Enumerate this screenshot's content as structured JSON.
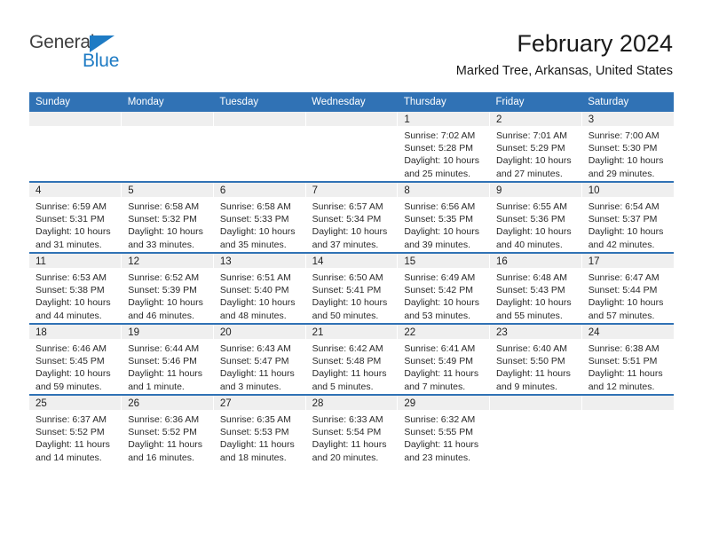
{
  "brand": {
    "name_part1": "General",
    "name_part2": "Blue",
    "triangle_icon": "triangle-icon",
    "color_dark": "#3F3F3F",
    "color_blue": "#1E7BC4"
  },
  "header": {
    "title": "February 2024",
    "subtitle": "Marked Tree, Arkansas, United States"
  },
  "theme": {
    "header_blue": "#3072B5",
    "daynum_band": "#EFEFEF",
    "text": "#2A2A2A"
  },
  "weekday_headers": [
    "Sunday",
    "Monday",
    "Tuesday",
    "Wednesday",
    "Thursday",
    "Friday",
    "Saturday"
  ],
  "weeks": [
    [
      {
        "blank": true,
        "day": ""
      },
      {
        "blank": true,
        "day": ""
      },
      {
        "blank": true,
        "day": ""
      },
      {
        "blank": true,
        "day": ""
      },
      {
        "blank": false,
        "day": "1",
        "sunrise": "Sunrise: 7:02 AM",
        "sunset": "Sunset: 5:28 PM",
        "daylight_line1": "Daylight: 10 hours",
        "daylight_line2": "and 25 minutes."
      },
      {
        "blank": false,
        "day": "2",
        "sunrise": "Sunrise: 7:01 AM",
        "sunset": "Sunset: 5:29 PM",
        "daylight_line1": "Daylight: 10 hours",
        "daylight_line2": "and 27 minutes."
      },
      {
        "blank": false,
        "day": "3",
        "sunrise": "Sunrise: 7:00 AM",
        "sunset": "Sunset: 5:30 PM",
        "daylight_line1": "Daylight: 10 hours",
        "daylight_line2": "and 29 minutes."
      }
    ],
    [
      {
        "blank": false,
        "day": "4",
        "sunrise": "Sunrise: 6:59 AM",
        "sunset": "Sunset: 5:31 PM",
        "daylight_line1": "Daylight: 10 hours",
        "daylight_line2": "and 31 minutes."
      },
      {
        "blank": false,
        "day": "5",
        "sunrise": "Sunrise: 6:58 AM",
        "sunset": "Sunset: 5:32 PM",
        "daylight_line1": "Daylight: 10 hours",
        "daylight_line2": "and 33 minutes."
      },
      {
        "blank": false,
        "day": "6",
        "sunrise": "Sunrise: 6:58 AM",
        "sunset": "Sunset: 5:33 PM",
        "daylight_line1": "Daylight: 10 hours",
        "daylight_line2": "and 35 minutes."
      },
      {
        "blank": false,
        "day": "7",
        "sunrise": "Sunrise: 6:57 AM",
        "sunset": "Sunset: 5:34 PM",
        "daylight_line1": "Daylight: 10 hours",
        "daylight_line2": "and 37 minutes."
      },
      {
        "blank": false,
        "day": "8",
        "sunrise": "Sunrise: 6:56 AM",
        "sunset": "Sunset: 5:35 PM",
        "daylight_line1": "Daylight: 10 hours",
        "daylight_line2": "and 39 minutes."
      },
      {
        "blank": false,
        "day": "9",
        "sunrise": "Sunrise: 6:55 AM",
        "sunset": "Sunset: 5:36 PM",
        "daylight_line1": "Daylight: 10 hours",
        "daylight_line2": "and 40 minutes."
      },
      {
        "blank": false,
        "day": "10",
        "sunrise": "Sunrise: 6:54 AM",
        "sunset": "Sunset: 5:37 PM",
        "daylight_line1": "Daylight: 10 hours",
        "daylight_line2": "and 42 minutes."
      }
    ],
    [
      {
        "blank": false,
        "day": "11",
        "sunrise": "Sunrise: 6:53 AM",
        "sunset": "Sunset: 5:38 PM",
        "daylight_line1": "Daylight: 10 hours",
        "daylight_line2": "and 44 minutes."
      },
      {
        "blank": false,
        "day": "12",
        "sunrise": "Sunrise: 6:52 AM",
        "sunset": "Sunset: 5:39 PM",
        "daylight_line1": "Daylight: 10 hours",
        "daylight_line2": "and 46 minutes."
      },
      {
        "blank": false,
        "day": "13",
        "sunrise": "Sunrise: 6:51 AM",
        "sunset": "Sunset: 5:40 PM",
        "daylight_line1": "Daylight: 10 hours",
        "daylight_line2": "and 48 minutes."
      },
      {
        "blank": false,
        "day": "14",
        "sunrise": "Sunrise: 6:50 AM",
        "sunset": "Sunset: 5:41 PM",
        "daylight_line1": "Daylight: 10 hours",
        "daylight_line2": "and 50 minutes."
      },
      {
        "blank": false,
        "day": "15",
        "sunrise": "Sunrise: 6:49 AM",
        "sunset": "Sunset: 5:42 PM",
        "daylight_line1": "Daylight: 10 hours",
        "daylight_line2": "and 53 minutes."
      },
      {
        "blank": false,
        "day": "16",
        "sunrise": "Sunrise: 6:48 AM",
        "sunset": "Sunset: 5:43 PM",
        "daylight_line1": "Daylight: 10 hours",
        "daylight_line2": "and 55 minutes."
      },
      {
        "blank": false,
        "day": "17",
        "sunrise": "Sunrise: 6:47 AM",
        "sunset": "Sunset: 5:44 PM",
        "daylight_line1": "Daylight: 10 hours",
        "daylight_line2": "and 57 minutes."
      }
    ],
    [
      {
        "blank": false,
        "day": "18",
        "sunrise": "Sunrise: 6:46 AM",
        "sunset": "Sunset: 5:45 PM",
        "daylight_line1": "Daylight: 10 hours",
        "daylight_line2": "and 59 minutes."
      },
      {
        "blank": false,
        "day": "19",
        "sunrise": "Sunrise: 6:44 AM",
        "sunset": "Sunset: 5:46 PM",
        "daylight_line1": "Daylight: 11 hours",
        "daylight_line2": "and 1 minute."
      },
      {
        "blank": false,
        "day": "20",
        "sunrise": "Sunrise: 6:43 AM",
        "sunset": "Sunset: 5:47 PM",
        "daylight_line1": "Daylight: 11 hours",
        "daylight_line2": "and 3 minutes."
      },
      {
        "blank": false,
        "day": "21",
        "sunrise": "Sunrise: 6:42 AM",
        "sunset": "Sunset: 5:48 PM",
        "daylight_line1": "Daylight: 11 hours",
        "daylight_line2": "and 5 minutes."
      },
      {
        "blank": false,
        "day": "22",
        "sunrise": "Sunrise: 6:41 AM",
        "sunset": "Sunset: 5:49 PM",
        "daylight_line1": "Daylight: 11 hours",
        "daylight_line2": "and 7 minutes."
      },
      {
        "blank": false,
        "day": "23",
        "sunrise": "Sunrise: 6:40 AM",
        "sunset": "Sunset: 5:50 PM",
        "daylight_line1": "Daylight: 11 hours",
        "daylight_line2": "and 9 minutes."
      },
      {
        "blank": false,
        "day": "24",
        "sunrise": "Sunrise: 6:38 AM",
        "sunset": "Sunset: 5:51 PM",
        "daylight_line1": "Daylight: 11 hours",
        "daylight_line2": "and 12 minutes."
      }
    ],
    [
      {
        "blank": false,
        "day": "25",
        "sunrise": "Sunrise: 6:37 AM",
        "sunset": "Sunset: 5:52 PM",
        "daylight_line1": "Daylight: 11 hours",
        "daylight_line2": "and 14 minutes."
      },
      {
        "blank": false,
        "day": "26",
        "sunrise": "Sunrise: 6:36 AM",
        "sunset": "Sunset: 5:52 PM",
        "daylight_line1": "Daylight: 11 hours",
        "daylight_line2": "and 16 minutes."
      },
      {
        "blank": false,
        "day": "27",
        "sunrise": "Sunrise: 6:35 AM",
        "sunset": "Sunset: 5:53 PM",
        "daylight_line1": "Daylight: 11 hours",
        "daylight_line2": "and 18 minutes."
      },
      {
        "blank": false,
        "day": "28",
        "sunrise": "Sunrise: 6:33 AM",
        "sunset": "Sunset: 5:54 PM",
        "daylight_line1": "Daylight: 11 hours",
        "daylight_line2": "and 20 minutes."
      },
      {
        "blank": false,
        "day": "29",
        "sunrise": "Sunrise: 6:32 AM",
        "sunset": "Sunset: 5:55 PM",
        "daylight_line1": "Daylight: 11 hours",
        "daylight_line2": "and 23 minutes."
      },
      {
        "blank": true,
        "day": ""
      },
      {
        "blank": true,
        "day": ""
      }
    ]
  ]
}
